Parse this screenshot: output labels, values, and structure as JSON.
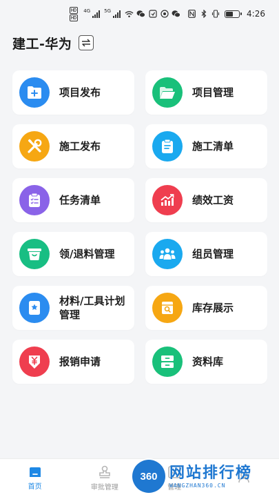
{
  "status_bar": {
    "hd_labels": [
      "HD",
      "HD"
    ],
    "signal_tags": [
      "4G",
      "5G"
    ],
    "time": "4:26",
    "battery_level": 0.6
  },
  "header": {
    "title": "建工-华为",
    "switch_icon": "swap-arrows-icon"
  },
  "modules": [
    {
      "label": "项目发布",
      "icon": "folder-add-icon",
      "color": "#2b8cf0"
    },
    {
      "label": "项目管理",
      "icon": "folder-open-icon",
      "color": "#19c07a"
    },
    {
      "label": "施工发布",
      "icon": "tools-icon",
      "color": "#f6a713"
    },
    {
      "label": "施工清单",
      "icon": "clipboard-icon",
      "color": "#1aa9ef"
    },
    {
      "label": "任务清单",
      "icon": "checklist-icon",
      "color": "#8a63e8"
    },
    {
      "label": "绩效工资",
      "icon": "growth-chart-icon",
      "color": "#ef3e4f"
    },
    {
      "label": "领/退料管理",
      "icon": "basket-icon",
      "color": "#18be83"
    },
    {
      "label": "组员管理",
      "icon": "group-icon",
      "color": "#1aa9ef"
    },
    {
      "label": "材料/工具计划管理",
      "icon": "star-bookmark-icon",
      "color": "#2b8cf0"
    },
    {
      "label": "库存展示",
      "icon": "inventory-search-icon",
      "color": "#f6a713"
    },
    {
      "label": "报销申请",
      "icon": "yen-reimburse-icon",
      "color": "#ef3e4f"
    },
    {
      "label": "资料库",
      "icon": "cabinet-icon",
      "color": "#19c07a"
    }
  ],
  "tabs": [
    {
      "label": "首页",
      "icon": "home-icon",
      "active": true
    },
    {
      "label": "审批管理",
      "icon": "stamp-icon",
      "active": false
    },
    {
      "label": "管理",
      "icon": "manage-icon",
      "active": false
    },
    {
      "label": "",
      "icon": "profile-icon",
      "active": false
    }
  ],
  "watermark": {
    "logo_text": "360",
    "title": "网站排行榜",
    "subtitle": "WANGZHAN360.CN"
  },
  "colors": {
    "accent": "#1e88e5",
    "background": "#f4f5f7",
    "card": "#ffffff"
  }
}
